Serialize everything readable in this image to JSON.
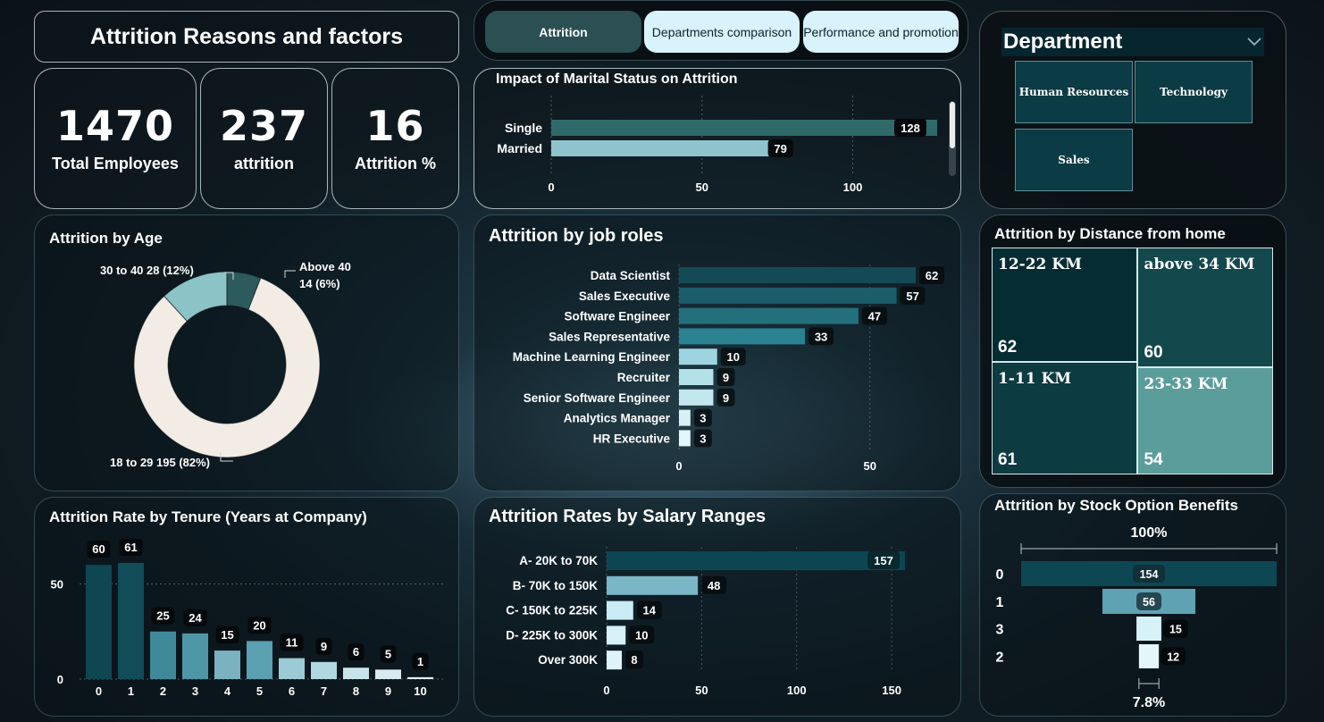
{
  "title": "Attrition Reasons and factors",
  "kpis": [
    {
      "value": "1470",
      "label": "Total Employees"
    },
    {
      "value": "237",
      "label": "attrition"
    },
    {
      "value": "16",
      "label": "Attrition %"
    }
  ],
  "nav": {
    "tabs": [
      {
        "label": "Attrition",
        "active": true
      },
      {
        "label": "Departments comparison",
        "active": false
      },
      {
        "label": "Performance and promotion",
        "active": false
      }
    ]
  },
  "department": {
    "title": "Department",
    "options": [
      "Human Resources",
      "Technology",
      "Sales"
    ]
  },
  "colors": {
    "dark_teal": "#0e4a56",
    "mid_teal": "#2f6f7a",
    "light_teal": "#5aa5b3",
    "pale": "#cfeef6",
    "cream": "#f2ece4"
  },
  "chart_data": [
    {
      "id": "marital",
      "type": "bar",
      "orientation": "horizontal",
      "title": "Impact of Marital Status on Attrition",
      "categories": [
        "Single",
        "Married"
      ],
      "values": [
        128,
        79
      ],
      "xticks": [
        "0",
        "50",
        "100"
      ],
      "xlim": [
        0,
        128
      ]
    },
    {
      "id": "age",
      "type": "pie",
      "title": "Attrition by Age",
      "categories": [
        "18 to 29",
        "30 to 40",
        "Above 40"
      ],
      "values": [
        195,
        28,
        14
      ],
      "percents": [
        "82%",
        "12%",
        "6%"
      ],
      "labels": [
        "18 to 29 195 (82%)",
        "30 to 40 28 (12%)",
        "Above 40",
        "14 (6%)"
      ]
    },
    {
      "id": "job_roles",
      "type": "bar",
      "orientation": "horizontal",
      "title": "Attrition by job roles",
      "categories": [
        "Data Scientist",
        "Sales Executive",
        "Software Engineer",
        "Sales Representative",
        "Machine Learning Engineer",
        "Recruiter",
        "Senior Software Engineer",
        "Analytics Manager",
        "HR Executive"
      ],
      "values": [
        62,
        57,
        47,
        33,
        10,
        9,
        9,
        3,
        3
      ],
      "xticks": [
        "0",
        "50"
      ],
      "xlim": [
        0,
        62
      ]
    },
    {
      "id": "distance",
      "type": "treemap",
      "title": "Attrition by Distance from home",
      "categories": [
        "12-22 KM",
        "above 34 KM",
        "1-11 KM",
        "23-33 KM"
      ],
      "values": [
        62,
        60,
        61,
        54
      ]
    },
    {
      "id": "tenure",
      "type": "bar",
      "title": "Attrition Rate by Tenure (Years at Company)",
      "categories": [
        "0",
        "1",
        "2",
        "3",
        "4",
        "5",
        "6",
        "7",
        "8",
        "9",
        "10"
      ],
      "values": [
        60,
        61,
        25,
        24,
        15,
        20,
        11,
        9,
        6,
        5,
        1
      ],
      "yticks": [
        "0",
        "50"
      ],
      "ylim": [
        0,
        61
      ]
    },
    {
      "id": "salary",
      "type": "bar",
      "orientation": "horizontal",
      "title": "Attrition Rates by Salary Ranges",
      "categories": [
        "A- 20K to 70K",
        "B- 70K to 150K",
        "C- 150K to 225K",
        "D- 225K to 300K",
        "Over 300K"
      ],
      "values": [
        157,
        48,
        14,
        10,
        8
      ],
      "xticks": [
        "0",
        "50",
        "100",
        "150"
      ],
      "xlim": [
        0,
        157
      ]
    },
    {
      "id": "stock",
      "type": "funnel",
      "title": "Attrition by Stock Option Benefits",
      "categories": [
        "0",
        "1",
        "3",
        "2"
      ],
      "values": [
        154,
        56,
        15,
        12
      ],
      "top_label": "100%",
      "bottom_label": "7.8%"
    }
  ]
}
